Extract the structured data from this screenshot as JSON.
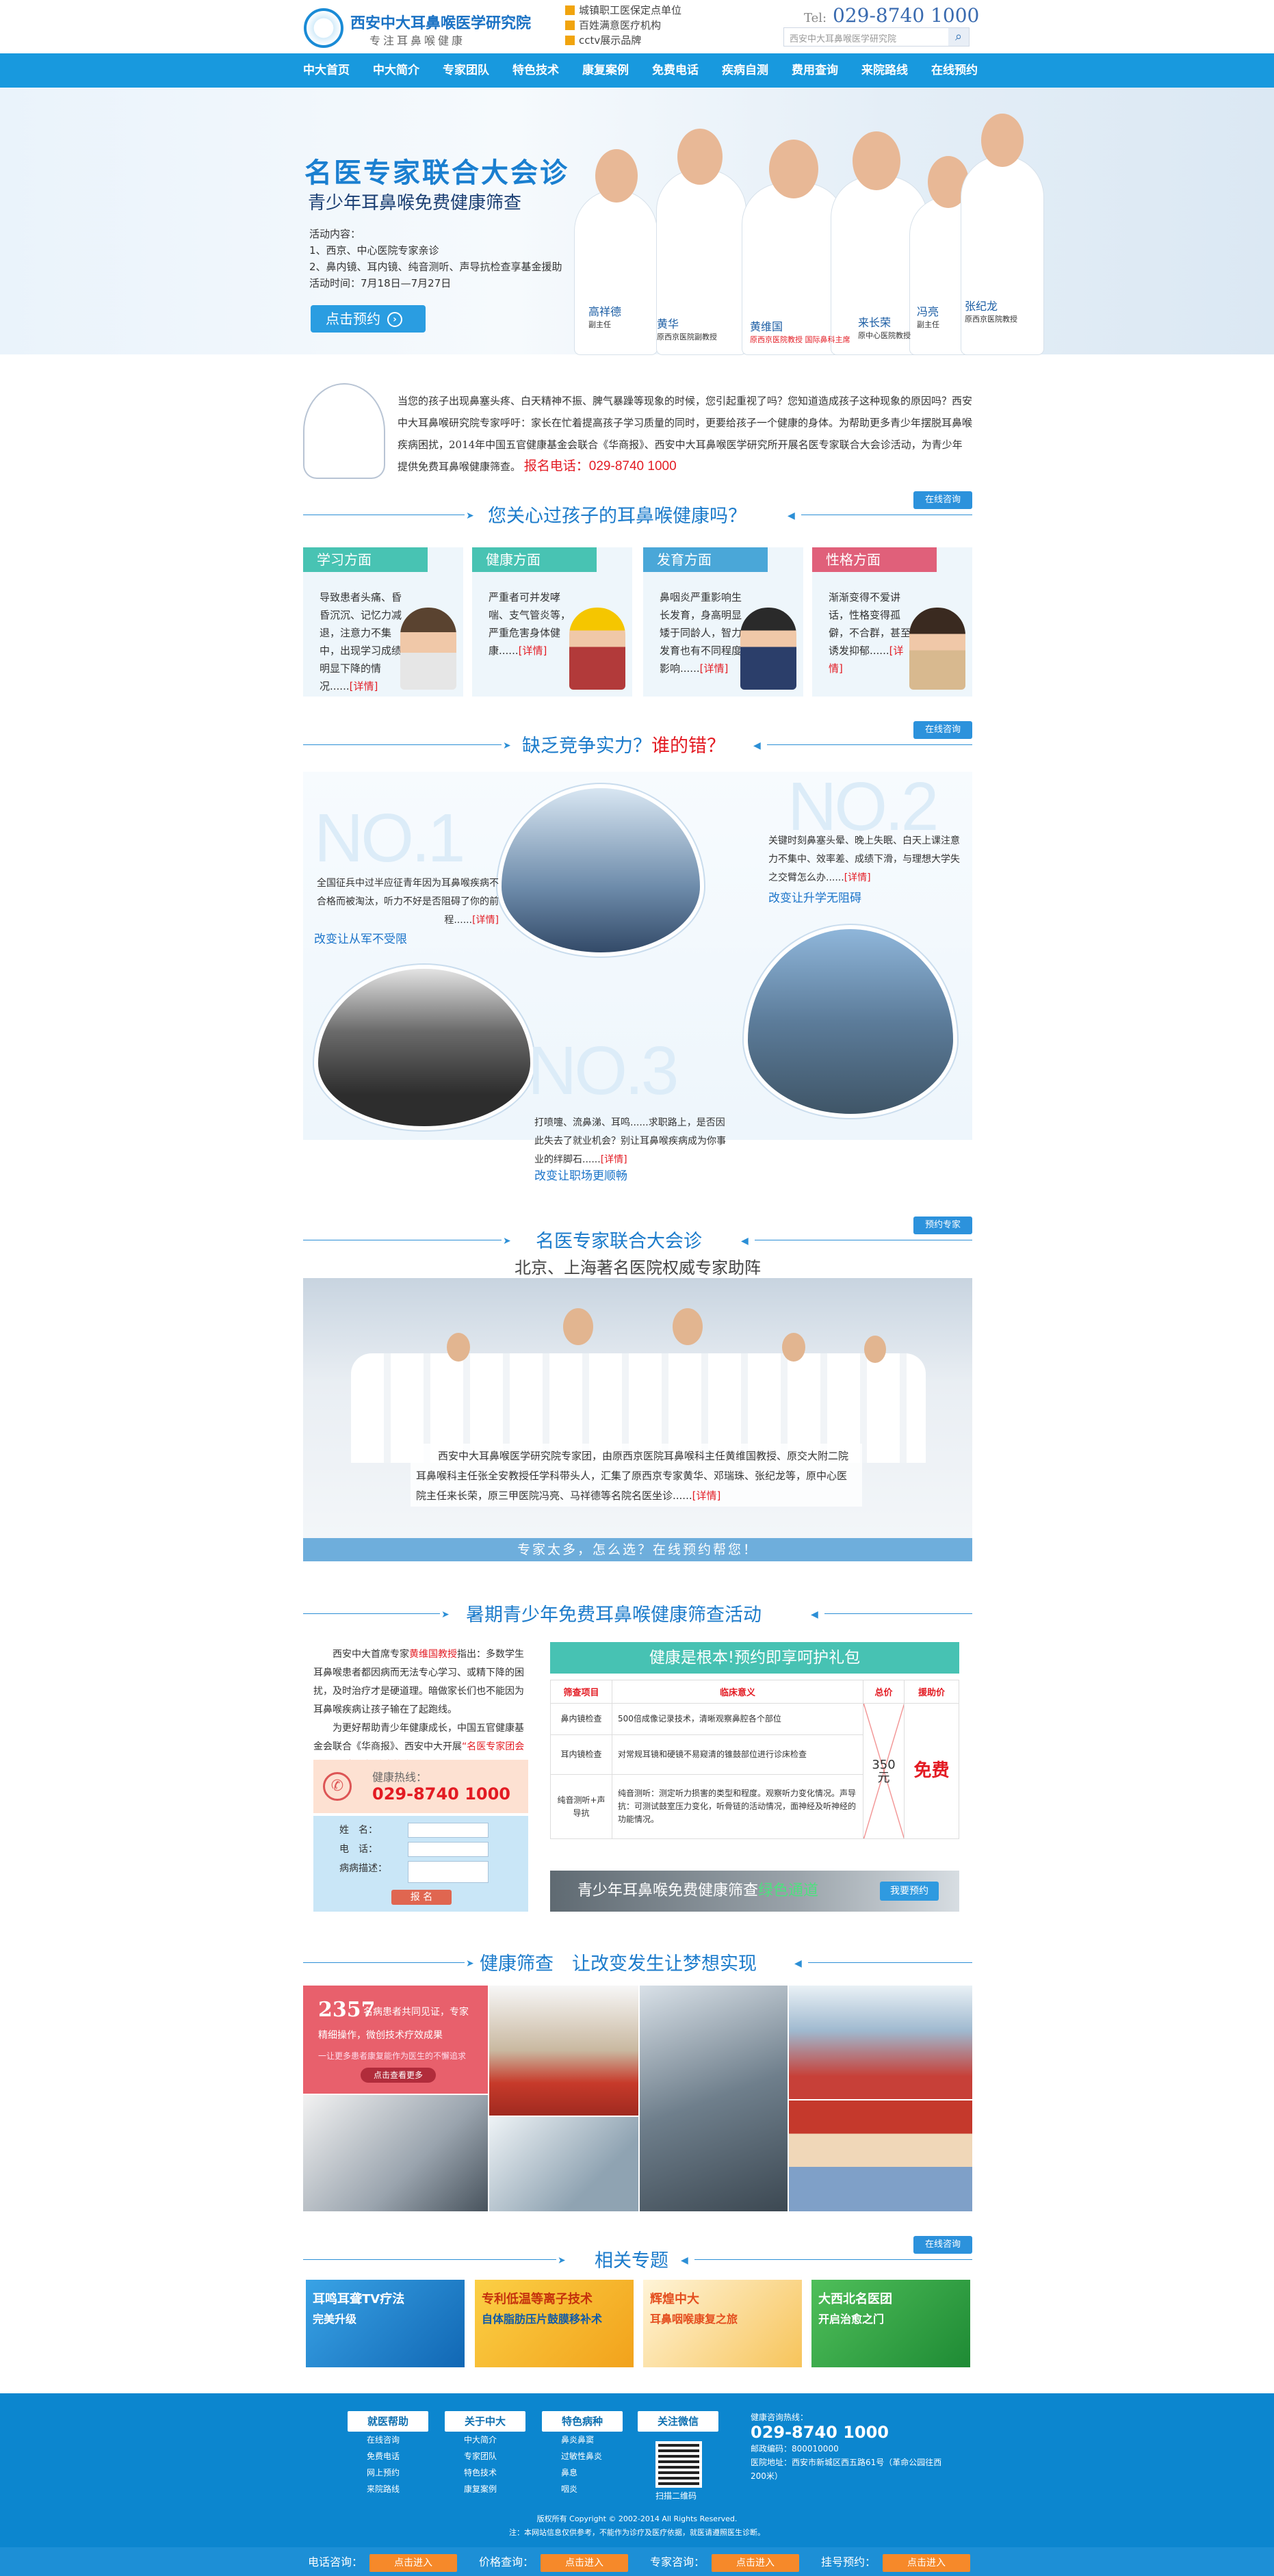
{
  "header": {
    "logo_title": "西安中大耳鼻喉医学研究院",
    "logo_slogan": "专注耳鼻喉健康",
    "badges": [
      "城镇职工医保定点单位",
      "百姓满意医疗机构",
      "cctv展示品牌"
    ],
    "tel_prefix": "Tel:",
    "tel": "029-8740 1000",
    "search_placeholder": "西安中大耳鼻喉医学研究院"
  },
  "nav": [
    "中大首页",
    "中大简介",
    "专家团队",
    "特色技术",
    "康复案例",
    "免费电话",
    "疾病自测",
    "费用查询",
    "来院路线",
    "在线预约"
  ],
  "banner": {
    "title": "名医专家联合大会诊",
    "subtitle": "青少年耳鼻喉免费健康筛查",
    "act_label": "活动内容：",
    "act_1": "1、西京、中心医院专家亲诊",
    "act_2": "2、鼻内镜、耳内镜、纯音测听、声导抗检查享基金援助",
    "act_time": "活动时间：7月18日—7月27日",
    "button": "点击预约",
    "doctors": [
      {
        "name": "高祥德",
        "title": "副主任"
      },
      {
        "name": "黄华",
        "title": "原西京医院副教授"
      },
      {
        "name": "黄维国",
        "title": "原西京医院教授 国际鼻科主席"
      },
      {
        "name": "来长荣",
        "title": "原中心医院教授"
      },
      {
        "name": "冯亮",
        "title": "副主任"
      },
      {
        "name": "张纪龙",
        "title": "原西京医院教授"
      }
    ]
  },
  "intro": {
    "text": "当您的孩子出现鼻塞头疼、白天精神不振、脾气暴躁等现象的时候，您引起重视了吗？您知道造成孩子这种现象的原因吗？西安中大耳鼻喉研究院专家呼吁：家长在忙着提高孩子学习质量的同时，更要给孩子一个健康的身体。为帮助更多青少年摆脱耳鼻喉疾病困扰，2014年中国五官健康基金会联合《华商报》、西安中大耳鼻喉医学研究所开展名医专家联合大会诊活动，为青少年提供免费耳鼻喉健康筛查。",
    "hotline": "报名电话：029-8740 1000"
  },
  "sec1": {
    "title": "您关心过孩子的耳鼻喉健康吗？",
    "tag": "在线咨询"
  },
  "cards": [
    {
      "title": "学习方面",
      "text": "导致患者头痛、昏昏沉沉、记忆力减退，注意力不集中，出现学习成绩明显下降的情况......",
      "more": "[详情]",
      "color": "#48c3b3"
    },
    {
      "title": "健康方面",
      "text": "严重者可并发哮喘、支气管炎等，严重危害身体健康......",
      "more": "[详情]",
      "color": "#48c3b3"
    },
    {
      "title": "发育方面",
      "text": "鼻咽炎严重影响生长发育，身高明显矮于同龄人，智力发育也有不同程度影响......",
      "more": "[详情]",
      "color": "#4aa7d8"
    },
    {
      "title": "性格方面",
      "text": "渐渐变得不爱讲话，性格变得孤僻，不合群，甚至诱发抑郁......",
      "more": "[详情]",
      "color": "#e0607a"
    }
  ],
  "sec2": {
    "title": "缺乏竞争实力？",
    "title_red": "谁的错？",
    "tag": "在线咨询"
  },
  "no": [
    {
      "no": "NO.1",
      "text": "全国征兵中过半应征青年因为耳鼻喉疾病不合格而被淘汰，听力不好是否阻碍了你的前程......",
      "more": "[详情]",
      "link": "改变让从军不受限"
    },
    {
      "no": "NO.2",
      "text": "关键时刻鼻塞头晕、晚上失眠、白天上课注意力不集中、效率差、成绩下滑，与理想大学失之交臂怎么办......",
      "more": "[详情]",
      "link": "改变让升学无阻碍"
    },
    {
      "no": "NO.3",
      "text": "打喷嚏、流鼻涕、耳鸣......求职路上，是否因此失去了就业机会？别让耳鼻喉疾病成为你事业的绊脚石......",
      "more": "[详情]",
      "link": "改变让职场更顺畅"
    }
  ],
  "sec3": {
    "title": "名医专家联合大会诊",
    "sub": "北京、上海著名医院权威专家助阵",
    "tag": "预约专家"
  },
  "expert": {
    "desc": "西安中大耳鼻喉医学研究院专家团，由原西京医院耳鼻喉科主任黄维国教授、原交大附二院耳鼻喉科主任张全安教授任学科带头人，汇集了原西京专家黄华、邓瑞珠、张纪龙等，原中心医院主任来长荣，原三甲医院冯亮、马祥德等名院名医坐诊......",
    "more": "[详情]",
    "bar": "专家太多，怎么选？在线预约帮您！"
  },
  "sec4": {
    "title": "暑期青少年免费耳鼻喉健康筛查活动"
  },
  "activity": {
    "p1a": "西安中大首席专家",
    "p1red": "黄维国教授",
    "p1b": "指出：多数学生耳鼻喉患者都因病而无法专心学习、或精下降的困扰，及时治疗才是硬道理。暗做家长们也不能因为耳鼻喉疾病让孩子输在了起跑线。",
    "p2a": "为更好帮助青少年健康成长，中国五官健康基金会联合《华商报》、西安中大开展",
    "p2red": "“名医专家团会诊 暑期青少年健康筛查活动”",
    "p2b": "。",
    "hot_label": "健康热线：",
    "hot_num": "029-8740 1000",
    "form": {
      "name": "姓　名：",
      "phone": "电　话：",
      "desc": "病病描述：",
      "submit": "报 名"
    }
  },
  "table": {
    "title": "健康是根本!预约即享呵护礼包",
    "headers": [
      "筛查项目",
      "临床意义",
      "总价",
      "援助价"
    ],
    "rows": [
      {
        "item": "鼻内镜检查",
        "meaning": "500倍成像记录技术，清晰观察鼻腔各个部位"
      },
      {
        "item": "耳内镜检查",
        "meaning": "对常规耳镜和硬镜不易窥清的锥鼓部位进行诊床检查"
      },
      {
        "item": "纯音测听+声导抗",
        "meaning": "纯音测听：测定听力损害的类型和程度。观察听力变化情况。声导抗：可测试鼓室压力变化，听骨链的活动情况，面神经及听神经的功能情况。"
      }
    ],
    "total": "350元",
    "free": "免费",
    "green_a": "青少年耳鼻喉免费健康筛查",
    "green_b": "绿色通道",
    "green_btn": "我要预约"
  },
  "sec5": {
    "title": "健康筛查　让改变发生让梦想实现"
  },
  "cases": {
    "num": "2357",
    "a": "名病患者共同见证，专家",
    "b": "精细操作，微创技术疗效成果",
    "c": "一让更多患者康复能作为医生的不懈追求",
    "btn": "点击查看更多"
  },
  "sec6": {
    "title": "相关专题",
    "tag": "在线咨询"
  },
  "topics": [
    {
      "t": "耳鸣耳聋TV疗法",
      "s": "完美升级",
      "bg": "#1f8ed8"
    },
    {
      "t": "专利低温等离子技术",
      "s": "自体脂肪压片鼓膜移补术",
      "bg": "#f2a21b"
    },
    {
      "t": "辉煌中大",
      "s": "耳鼻咽喉康复之旅",
      "bg": "#e44e1f"
    },
    {
      "t": "大西北名医团",
      "s": "开启治愈之门",
      "bg": "#39a845"
    }
  ],
  "footer": {
    "cols": [
      {
        "h": "就医帮助",
        "items": [
          "在线咨询",
          "免费电话",
          "网上预约",
          "来院路线"
        ]
      },
      {
        "h": "关于中大",
        "items": [
          "中大简介",
          "专家团队",
          "特色技术",
          "康复案例"
        ]
      },
      {
        "h": "特色病种",
        "items": [
          "鼻炎鼻窦",
          "过敏性鼻炎",
          "鼻息",
          "咽炎"
        ]
      },
      {
        "h": "关注微信",
        "items": [
          "扫描二维码"
        ]
      }
    ],
    "contact_label": "健康咨询热线：",
    "contact_num": "029-8740 1000",
    "postcode": "邮政编码：800010000",
    "address": "医院地址：西安市新城区西五路61号（革命公园往西200米）",
    "copy1": "版权所有 Copyright © 2002-2014 All Rights Reserved.",
    "copy2": "注：本网站信息仅供参考，不能作为诊疗及医疗依据，就医请遵照医生诊断。"
  },
  "bottom": [
    {
      "label": "电话咨询：",
      "btn": "点击进入"
    },
    {
      "label": "价格查询：",
      "btn": "点击进入"
    },
    {
      "label": "专家咨询：",
      "btn": "点击进入"
    },
    {
      "label": "挂号预约：",
      "btn": "点击进入"
    }
  ]
}
